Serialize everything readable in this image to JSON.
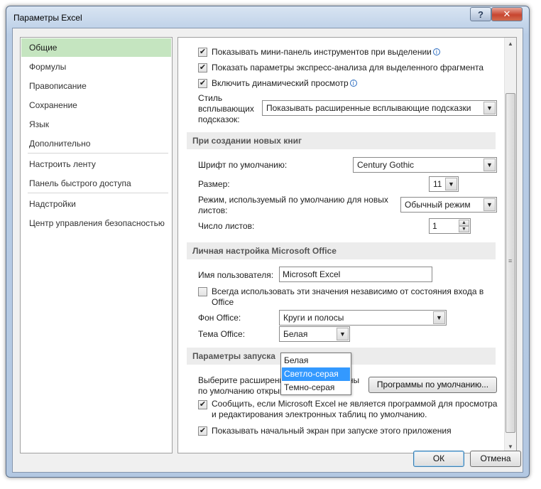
{
  "window": {
    "title": "Параметры Excel",
    "help_label": "?",
    "close_label": "✕"
  },
  "sidebar": {
    "items": [
      {
        "label": "Общие"
      },
      {
        "label": "Формулы"
      },
      {
        "label": "Правописание"
      },
      {
        "label": "Сохранение"
      },
      {
        "label": "Язык"
      },
      {
        "label": "Дополнительно"
      },
      {
        "label": "Настроить ленту"
      },
      {
        "label": "Панель быстрого доступа"
      },
      {
        "label": "Надстройки"
      },
      {
        "label": "Центр управления безопасностью"
      }
    ],
    "selected_index": 0
  },
  "ui_options": {
    "mini_toolbar": {
      "label": "Показывать мини-панель инструментов при выделении",
      "checked": true
    },
    "quick_analysis": {
      "label": "Показать параметры экспресс-анализа для выделенного фрагмента",
      "checked": true
    },
    "live_preview": {
      "label": "Включить динамический просмотр",
      "checked": true
    },
    "tooltip_style": {
      "label": "Стиль всплывающих подсказок:",
      "value": "Показывать расширенные всплывающие подсказки"
    }
  },
  "new_workbook": {
    "header": "При создании новых книг",
    "font_label": "Шрифт по умолчанию:",
    "font_value": "Century Gothic",
    "size_label": "Размер:",
    "size_value": "11",
    "view_label": "Режим, используемый по умолчанию для новых листов:",
    "view_value": "Обычный режим",
    "sheets_label": "Число листов:",
    "sheets_value": "1"
  },
  "personalize": {
    "header": "Личная настройка Microsoft Office",
    "username_label": "Имя пользователя:",
    "username_value": "Microsoft Excel",
    "always_use": {
      "label": "Всегда использовать эти значения независимо от состояния входа в Office",
      "checked": false
    },
    "background_label": "Фон Office:",
    "background_value": "Круги и полосы",
    "theme_label": "Тема Office:",
    "theme_value": "Белая",
    "theme_options": [
      "Белая",
      "Светло-серая",
      "Темно-серая"
    ],
    "theme_highlighted_index": 1
  },
  "startup": {
    "header": "Параметры запуска",
    "extensions_label": "Выберите расширения, которые должны по умолчанию открываться в Excel:",
    "default_programs_button": "Программы по умолчанию...",
    "notify_default": {
      "label": "Сообщить, если Microsoft Excel не является программой для просмотра и редактирования электронных таблиц по умолчанию.",
      "checked": true
    },
    "show_start_screen": {
      "label": "Показывать начальный экран при запуске этого приложения",
      "checked": true
    }
  },
  "footer": {
    "ok_label": "ОК",
    "cancel_label": "Отмена"
  },
  "icons": {
    "check": "✔",
    "dropdown": "▼",
    "info": "i",
    "spin_up": "▲",
    "spin_down": "▼"
  },
  "colors": {
    "selection": "#c5e5c0",
    "highlight": "#3399ff",
    "close_button": "#c8452f"
  }
}
